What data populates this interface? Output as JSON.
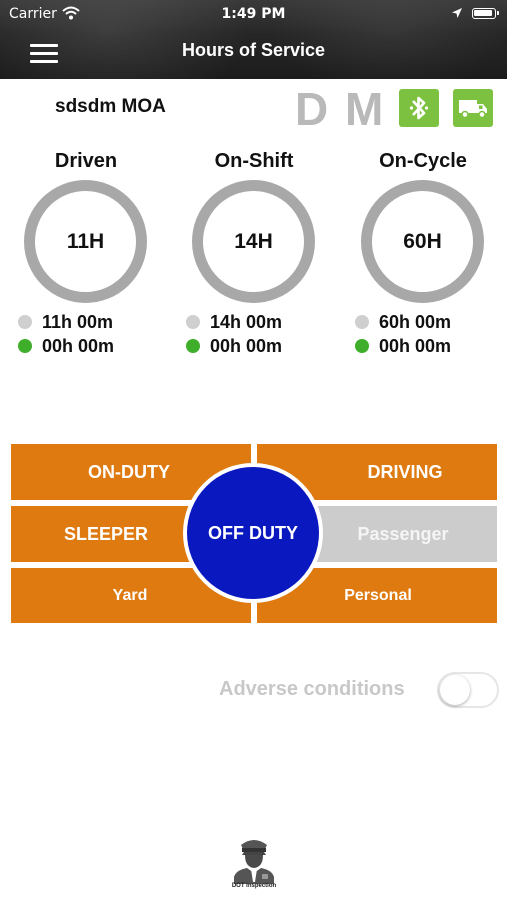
{
  "status_bar": {
    "carrier": "Carrier",
    "time": "1:49 PM"
  },
  "header": {
    "title": "Hours of Service"
  },
  "driver": {
    "name": "sdsdm MOA",
    "letter_d": "D",
    "letter_m": "M"
  },
  "gauges": [
    {
      "label": "Driven",
      "limit": "11H",
      "total": "11h 00m",
      "remaining": "00h 00m"
    },
    {
      "label": "On-Shift",
      "limit": "14H",
      "total": "14h 00m",
      "remaining": "00h 00m"
    },
    {
      "label": "On-Cycle",
      "limit": "60H",
      "total": "60h 00m",
      "remaining": "00h 00m"
    }
  ],
  "duty": {
    "on_duty": "ON-DUTY",
    "driving": "DRIVING",
    "sleeper": "SLEEPER",
    "passenger": "Passenger",
    "yard": "Yard",
    "personal": "Personal",
    "off_duty": "OFF DUTY"
  },
  "adverse": {
    "label": "Adverse conditions",
    "enabled": false
  },
  "dot": {
    "caption": "DOT Inspection"
  },
  "colors": {
    "duty_orange": "#de7a10",
    "off_duty_blue": "#0a18bf",
    "passenger_gray": "#cccccc",
    "accent_green": "#7dc140",
    "ring_gray": "#a8a8a8",
    "dot_gray": "#cfcfcf",
    "dot_green": "#3fae2a"
  },
  "icons": {
    "menu": "hamburger-icon",
    "bluetooth": "bluetooth-icon",
    "truck": "truck-icon",
    "dot_officer": "officer-icon",
    "wifi": "wifi-icon",
    "location": "location-arrow-icon",
    "battery": "battery-icon"
  }
}
